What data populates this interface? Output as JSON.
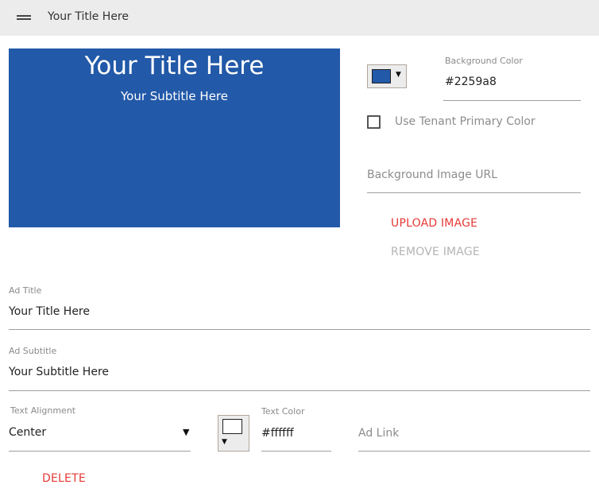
{
  "appbar": {
    "menu_icon": "hamburger-menu-icon",
    "title": "Your Title Here"
  },
  "preview": {
    "background_color": "#2259a8",
    "title": "Your Title Here",
    "subtitle": "Your Subtitle Here",
    "text_color": "#ffffff"
  },
  "background": {
    "color_label": "Background Color",
    "color_value": "#2259a8",
    "swatch_dropdown_icon": "dropdown-arrow-icon",
    "use_tenant_label": "Use Tenant Primary Color",
    "use_tenant_checked": false,
    "image_url_placeholder": "Background Image URL",
    "upload_label": "UPLOAD IMAGE",
    "remove_label": "REMOVE IMAGE"
  },
  "ad": {
    "title_label": "Ad Title",
    "title_value": "Your Title Here",
    "subtitle_label": "Ad Subtitle",
    "subtitle_value": "Your Subtitle Here",
    "alignment_label": "Text Alignment",
    "alignment_value": "Center",
    "text_color_label": "Text Color",
    "text_color_value": "#ffffff",
    "text_swatch_color": "#ffffff",
    "link_placeholder": "Ad Link",
    "delete_label": "DELETE"
  },
  "colors": {
    "accent_red": "#e53935",
    "disabled_gray": "#b4b4b4",
    "appbar_bg": "#ececec"
  }
}
